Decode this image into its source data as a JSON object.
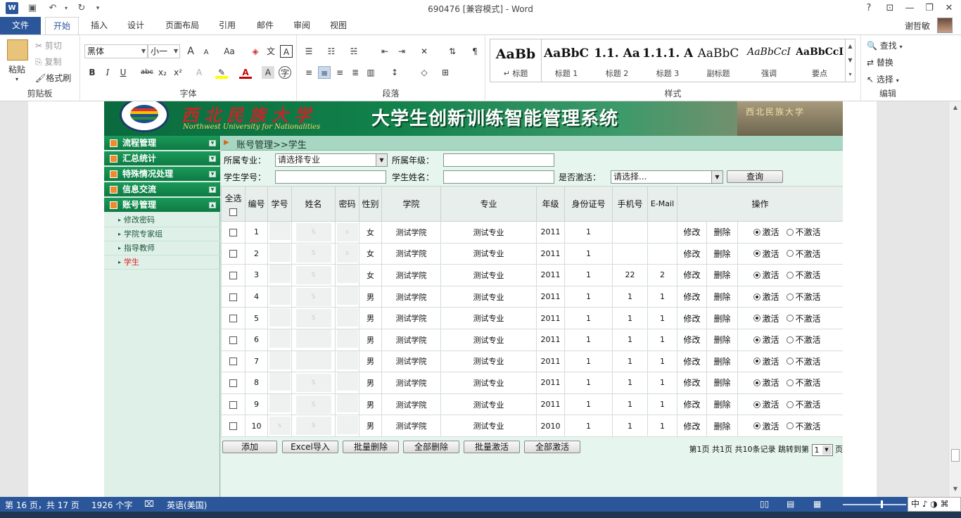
{
  "titlebar": {
    "doc_title": "690476 [兼容模式] - Word",
    "help": "?",
    "ribbon_display": "⊡",
    "minimize": "—",
    "restore": "❐",
    "close": "✕",
    "save_icon": "💾",
    "undo_icon": "↶",
    "redo_icon": "↻",
    "customize_icon": "▾"
  },
  "tabs": [
    "文件",
    "开始",
    "插入",
    "设计",
    "页面布局",
    "引用",
    "邮件",
    "审阅",
    "视图"
  ],
  "user": {
    "name": "谢哲敏"
  },
  "ribbon": {
    "clipboard": {
      "paste": "粘贴",
      "cut": "剪切",
      "copy": "复制",
      "format_painter": "格式刷",
      "label": "剪贴板"
    },
    "font": {
      "font_name": "黑体",
      "font_size": "小一",
      "grow": "A",
      "shrink": "A",
      "case": "Aa",
      "bold": "B",
      "italic": "I",
      "underline": "U",
      "strike": "abc",
      "sub": "x₂",
      "sup": "x²",
      "label": "字体"
    },
    "paragraph": {
      "label": "段落"
    },
    "styles": {
      "label": "样式",
      "items": [
        {
          "sample": "AaBb",
          "name": "↵ 标题"
        },
        {
          "sample": "AaBbC",
          "name": "标题 1"
        },
        {
          "sample": "1.1. Aa",
          "name": "标题 2"
        },
        {
          "sample": "1.1.1. A",
          "name": "标题 3"
        },
        {
          "sample": "AaBbC",
          "name": "副标题"
        },
        {
          "sample": "AaBbCcI",
          "name": "强调"
        },
        {
          "sample": "AaBbCcI",
          "name": "要点"
        }
      ]
    },
    "editing": {
      "find": "查找",
      "replace": "替换",
      "select": "选择",
      "label": "编辑"
    }
  },
  "web": {
    "banner": {
      "uni_name": "西北民族大学",
      "uni_en": "Northwest University for Nationalities",
      "system_title": "大学生创新训练智能管理系统",
      "gate_text": "西北民族大学"
    },
    "sidebar": {
      "heads": [
        "流程管理",
        "汇总统计",
        "特殊情况处理",
        "信息交流",
        "账号管理"
      ],
      "subs": [
        "修改密码",
        "学院专家组",
        "指导教师",
        "学生"
      ]
    },
    "breadcrumb": "账号管理>>学生",
    "filters": {
      "major_label": "所属专业：",
      "major_value": "请选择专业",
      "grade_label": "所属年级：",
      "grade_value": "",
      "sid_label": "学生学号：",
      "sid_value": "",
      "sname_label": "学生姓名：",
      "sname_value": "",
      "active_label": "是否激活：",
      "active_value": "请选择...",
      "query": "查询"
    },
    "table": {
      "headers": [
        "全选",
        "编号",
        "学号",
        "姓名",
        "密码",
        "性别",
        "学院",
        "专业",
        "年级",
        "身份证号",
        "手机号",
        "E-Mail",
        "操作"
      ],
      "edit": "修改",
      "delete": "删除",
      "activate": "激活",
      "deactivate": "不激活",
      "rows": [
        {
          "no": "1",
          "sid": "",
          "name": "S",
          "pwd": "s",
          "gender": "女",
          "college": "测试学院",
          "major": "测试专业",
          "grade": "2011",
          "idcard": "1",
          "phone": "",
          "email": ""
        },
        {
          "no": "2",
          "sid": "",
          "name": "S",
          "pwd": "s",
          "gender": "女",
          "college": "测试学院",
          "major": "测试专业",
          "grade": "2011",
          "idcard": "1",
          "phone": "",
          "email": ""
        },
        {
          "no": "3",
          "sid": "",
          "name": "S",
          "pwd": "",
          "gender": "女",
          "college": "测试学院",
          "major": "测试专业",
          "grade": "2011",
          "idcard": "1",
          "phone": "22",
          "email": "2"
        },
        {
          "no": "4",
          "sid": "",
          "name": "S",
          "pwd": "",
          "gender": "男",
          "college": "测试学院",
          "major": "测试专业",
          "grade": "2011",
          "idcard": "1",
          "phone": "1",
          "email": "1"
        },
        {
          "no": "5",
          "sid": "",
          "name": "S",
          "pwd": "",
          "gender": "男",
          "college": "测试学院",
          "major": "测试专业",
          "grade": "2011",
          "idcard": "1",
          "phone": "1",
          "email": "1"
        },
        {
          "no": "6",
          "sid": "",
          "name": "",
          "pwd": "",
          "gender": "男",
          "college": "测试学院",
          "major": "测试专业",
          "grade": "2011",
          "idcard": "1",
          "phone": "1",
          "email": "1"
        },
        {
          "no": "7",
          "sid": "",
          "name": "",
          "pwd": "",
          "gender": "男",
          "college": "测试学院",
          "major": "测试专业",
          "grade": "2011",
          "idcard": "1",
          "phone": "1",
          "email": "1"
        },
        {
          "no": "8",
          "sid": "",
          "name": "S",
          "pwd": "",
          "gender": "男",
          "college": "测试学院",
          "major": "测试专业",
          "grade": "2011",
          "idcard": "1",
          "phone": "1",
          "email": "1"
        },
        {
          "no": "9",
          "sid": "",
          "name": "S",
          "pwd": "",
          "gender": "男",
          "college": "测试学院",
          "major": "测试专业",
          "grade": "2011",
          "idcard": "1",
          "phone": "1",
          "email": "1"
        },
        {
          "no": "10",
          "sid": "s",
          "name": "S",
          "pwd": "",
          "gender": "男",
          "college": "测试学院",
          "major": "测试专业",
          "grade": "2010",
          "idcard": "1",
          "phone": "1",
          "email": "1"
        }
      ]
    },
    "actions": [
      "添加",
      "Excel导入",
      "批量删除",
      "全部删除",
      "批量激活",
      "全部激活"
    ],
    "pager": {
      "text": "第1页 共1页 共10条记录 跳转到第",
      "page": "1",
      "suffix": "页"
    }
  },
  "status": {
    "page": "第 16 页，共 17 页",
    "words": "1926 个字",
    "lang": "英语(美国)",
    "ime": "中 ♪ ◑ ⌘"
  }
}
